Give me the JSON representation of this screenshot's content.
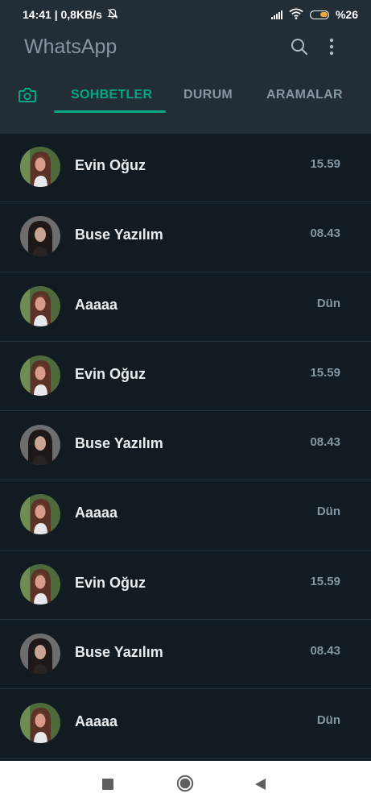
{
  "status_bar": {
    "time_speed": "14:41 | 0,8KB/s",
    "battery_text": "%26",
    "icons": [
      "mute-bell-icon",
      "signal-icon",
      "wifi-icon",
      "battery-icon"
    ]
  },
  "app": {
    "title": "WhatsApp",
    "icons": [
      "search-icon",
      "more-vert-icon"
    ]
  },
  "tabs": [
    {
      "label": "",
      "icon": "camera-icon"
    },
    {
      "label": "SOHBETLER",
      "active": true
    },
    {
      "label": "DURUM"
    },
    {
      "label": "ARAMALAR"
    }
  ],
  "chats": [
    {
      "name": "Evin Oğuz",
      "time": "15.59",
      "avatar": "avatar-a"
    },
    {
      "name": "Buse Yazılım",
      "time": "08.43",
      "avatar": "avatar-b"
    },
    {
      "name": "Aaaaa",
      "time": "Dün",
      "avatar": "avatar-a"
    },
    {
      "name": "Evin Oğuz",
      "time": "15.59",
      "avatar": "avatar-a"
    },
    {
      "name": "Buse Yazılım",
      "time": "08.43",
      "avatar": "avatar-b"
    },
    {
      "name": "Aaaaa",
      "time": "Dün",
      "avatar": "avatar-a"
    },
    {
      "name": "Evin Oğuz",
      "time": "15.59",
      "avatar": "avatar-a"
    },
    {
      "name": "Buse Yazılım",
      "time": "08.43",
      "avatar": "avatar-b"
    },
    {
      "name": "Aaaaa",
      "time": "Dün",
      "avatar": "avatar-a"
    }
  ],
  "navbar": {
    "icons": [
      "recents-icon",
      "home-icon",
      "back-icon"
    ]
  },
  "colors": {
    "background": "#121b22",
    "appbar": "#232d36",
    "accent": "#00a884",
    "muted_text": "#8696a0",
    "primary_text": "#e9edef"
  }
}
